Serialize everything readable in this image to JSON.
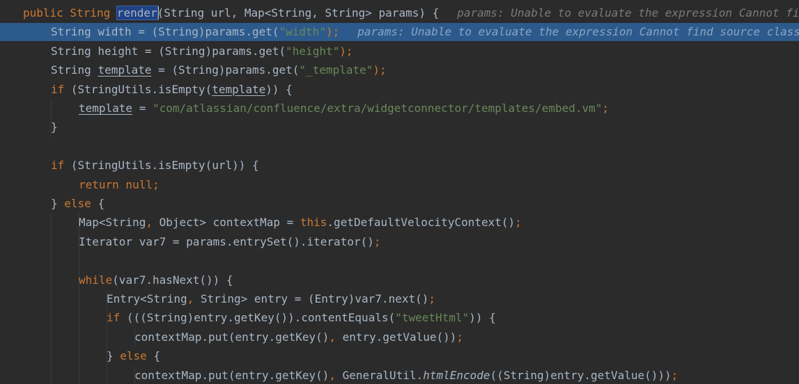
{
  "editor": {
    "lines": [
      {
        "indent": 0,
        "tokens": [
          {
            "t": "public String ",
            "c": "kw-first"
          },
          {
            "t": "render",
            "c": "sel"
          },
          {
            "t": "(String url, Map<String, String> params) {",
            "c": "txt"
          }
        ],
        "hint": "params: Unable to evaluate the expression Cannot find source class for java.util.LinkedHashMap"
      },
      {
        "indent": 1,
        "exec": true,
        "tokens": [
          {
            "t": "String width = (String)params.get(",
            "c": "txt"
          },
          {
            "t": "\"width\"",
            "c": "str"
          },
          {
            "t": ");",
            "c": "kw"
          }
        ],
        "hint": "params: Unable to evaluate the expression Cannot find source class for java.util.LinkedHashMap"
      },
      {
        "indent": 1,
        "tokens": [
          {
            "t": "String height = (String)params.get(",
            "c": "txt"
          },
          {
            "t": "\"height\"",
            "c": "str"
          },
          {
            "t": ");",
            "c": "kw"
          }
        ]
      },
      {
        "indent": 1,
        "tokens": [
          {
            "t": "String ",
            "c": "txt"
          },
          {
            "t": "template",
            "c": "u"
          },
          {
            "t": " = (String)params.get(",
            "c": "txt"
          },
          {
            "t": "\"_template\"",
            "c": "str"
          },
          {
            "t": ");",
            "c": "kw"
          }
        ]
      },
      {
        "indent": 1,
        "tokens": [
          {
            "t": "if ",
            "c": "kw"
          },
          {
            "t": "(StringUtils.isEmpty(",
            "c": "txt"
          },
          {
            "t": "template",
            "c": "u"
          },
          {
            "t": ")) {",
            "c": "txt"
          }
        ]
      },
      {
        "indent": 2,
        "tokens": [
          {
            "t": "template",
            "c": "u"
          },
          {
            "t": " = ",
            "c": "txt"
          },
          {
            "t": "\"com/atlassian/confluence/extra/widgetconnector/templates/embed.vm\"",
            "c": "str"
          },
          {
            "t": ";",
            "c": "kw"
          }
        ]
      },
      {
        "indent": 1,
        "tokens": [
          {
            "t": "}",
            "c": "txt"
          }
        ]
      },
      {
        "indent": 0,
        "tokens": []
      },
      {
        "indent": 1,
        "tokens": [
          {
            "t": "if ",
            "c": "kw"
          },
          {
            "t": "(StringUtils.isEmpty(url)) {",
            "c": "txt"
          }
        ]
      },
      {
        "indent": 2,
        "tokens": [
          {
            "t": "return null;",
            "c": "kw"
          }
        ]
      },
      {
        "indent": 1,
        "tokens": [
          {
            "t": "} ",
            "c": "txt"
          },
          {
            "t": "else ",
            "c": "kw"
          },
          {
            "t": "{",
            "c": "txt"
          }
        ]
      },
      {
        "indent": 2,
        "tokens": [
          {
            "t": "Map<String",
            "c": "txt"
          },
          {
            "t": ", ",
            "c": "kw"
          },
          {
            "t": "Object> contextMap = ",
            "c": "txt"
          },
          {
            "t": "this",
            "c": "kw"
          },
          {
            "t": ".getDefaultVelocityContext()",
            "c": "txt"
          },
          {
            "t": ";",
            "c": "kw"
          }
        ]
      },
      {
        "indent": 2,
        "tokens": [
          {
            "t": "Iterator var7 = params.entrySet().iterator()",
            "c": "txt"
          },
          {
            "t": ";",
            "c": "kw"
          }
        ]
      },
      {
        "indent": 0,
        "tokens": []
      },
      {
        "indent": 2,
        "tokens": [
          {
            "t": "while",
            "c": "kw"
          },
          {
            "t": "(var7.hasNext()) {",
            "c": "txt"
          }
        ]
      },
      {
        "indent": 3,
        "tokens": [
          {
            "t": "Entry<String",
            "c": "txt"
          },
          {
            "t": ", ",
            "c": "kw"
          },
          {
            "t": "String> entry = (Entry)var7.next()",
            "c": "txt"
          },
          {
            "t": ";",
            "c": "kw"
          }
        ]
      },
      {
        "indent": 3,
        "tokens": [
          {
            "t": "if ",
            "c": "kw"
          },
          {
            "t": "(((String)entry.getKey()).contentEquals(",
            "c": "txt"
          },
          {
            "t": "\"tweetHtml\"",
            "c": "str"
          },
          {
            "t": ")) {",
            "c": "txt"
          }
        ]
      },
      {
        "indent": 4,
        "tokens": [
          {
            "t": "contextMap.put(entry.getKey()",
            "c": "txt"
          },
          {
            "t": ", ",
            "c": "kw"
          },
          {
            "t": "entry.getValue())",
            "c": "txt"
          },
          {
            "t": ";",
            "c": "kw"
          }
        ]
      },
      {
        "indent": 3,
        "tokens": [
          {
            "t": "} ",
            "c": "txt"
          },
          {
            "t": "else ",
            "c": "kw"
          },
          {
            "t": "{",
            "c": "txt"
          }
        ]
      },
      {
        "indent": 4,
        "tokens": [
          {
            "t": "contextMap.put(entry.getKey()",
            "c": "txt"
          },
          {
            "t": ", ",
            "c": "kw"
          },
          {
            "t": "GeneralUtil.",
            "c": "txt"
          },
          {
            "t": "htmlEncode",
            "c": "ital"
          },
          {
            "t": "((String)entry.getValue()))",
            "c": "txt"
          },
          {
            "t": ";",
            "c": "kw"
          }
        ]
      }
    ]
  }
}
